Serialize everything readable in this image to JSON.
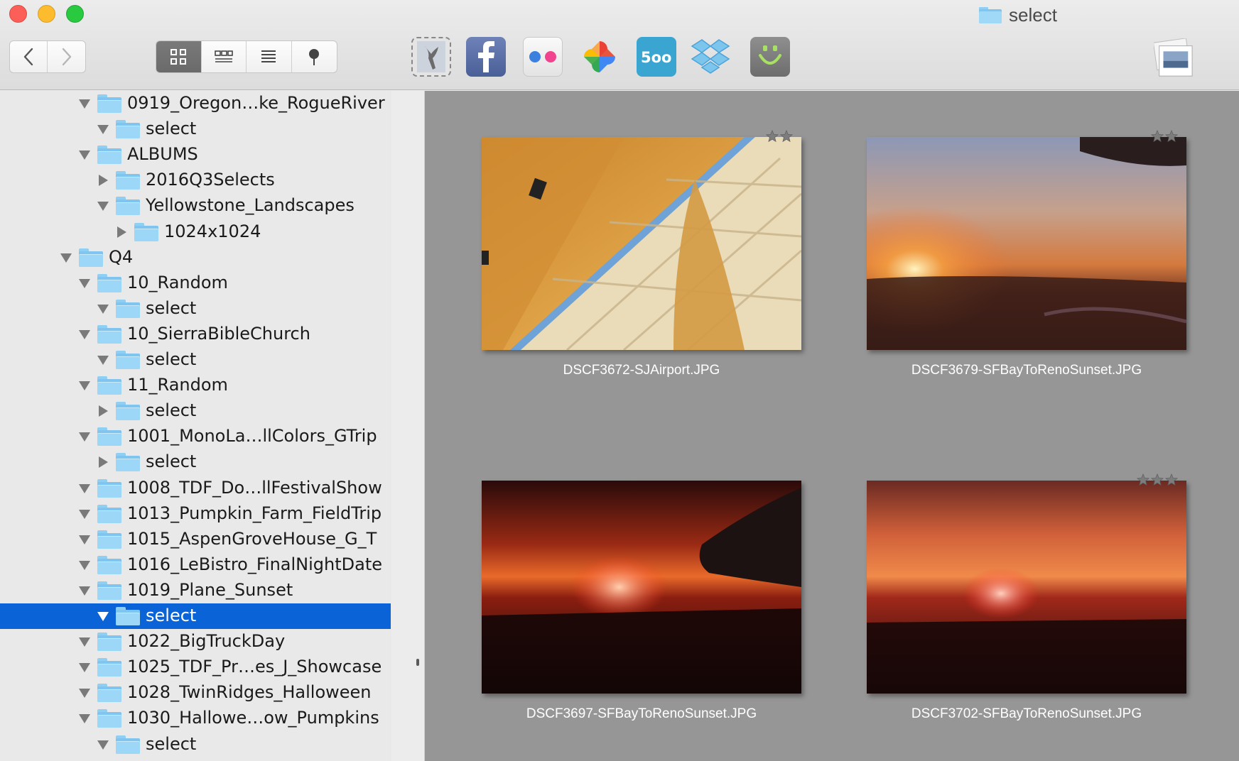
{
  "window": {
    "title": "select"
  },
  "toolbar": {
    "nav": [
      {
        "icon": "chevron-left-icon"
      },
      {
        "icon": "chevron-right-icon"
      }
    ],
    "view_modes": [
      {
        "icon": "grid-view-icon",
        "active": true
      },
      {
        "icon": "filmstrip-view-icon",
        "active": false
      },
      {
        "icon": "list-view-icon",
        "active": false
      },
      {
        "icon": "map-pin-icon",
        "active": false
      }
    ],
    "share_services": [
      "photos-hawk-icon",
      "facebook-icon",
      "flickr-icon",
      "google-photos-icon",
      "500px-icon",
      "dropbox-icon",
      "smugmug-icon"
    ],
    "slideshow_icon": "slideshow-icon"
  },
  "sidebar": {
    "items": [
      {
        "label": "0919_Oregon…ke_RogueRiver",
        "level": 2,
        "expanded": true,
        "selected": false
      },
      {
        "label": "select",
        "level": 3,
        "expanded": true,
        "selected": false
      },
      {
        "label": "ALBUMS",
        "level": 2,
        "expanded": true,
        "selected": false
      },
      {
        "label": "2016Q3Selects",
        "level": 3,
        "expanded": false,
        "selected": false
      },
      {
        "label": "Yellowstone_Landscapes",
        "level": 3,
        "expanded": true,
        "selected": false
      },
      {
        "label": "1024x1024",
        "level": 4,
        "expanded": false,
        "selected": false
      },
      {
        "label": "Q4",
        "level": 1,
        "expanded": true,
        "selected": false
      },
      {
        "label": "10_Random",
        "level": 2,
        "expanded": true,
        "selected": false
      },
      {
        "label": "select",
        "level": 3,
        "expanded": true,
        "selected": false
      },
      {
        "label": "10_SierraBibleChurch",
        "level": 2,
        "expanded": true,
        "selected": false
      },
      {
        "label": "select",
        "level": 3,
        "expanded": true,
        "selected": false
      },
      {
        "label": "11_Random",
        "level": 2,
        "expanded": true,
        "selected": false
      },
      {
        "label": "select",
        "level": 3,
        "expanded": false,
        "selected": false
      },
      {
        "label": "1001_MonoLa…llColors_GTrip",
        "level": 2,
        "expanded": true,
        "selected": false
      },
      {
        "label": "select",
        "level": 3,
        "expanded": false,
        "selected": false
      },
      {
        "label": "1008_TDF_Do…llFestivalShow",
        "level": 2,
        "expanded": true,
        "selected": false
      },
      {
        "label": "1013_Pumpkin_Farm_FieldTrip",
        "level": 2,
        "expanded": true,
        "selected": false
      },
      {
        "label": "1015_AspenGroveHouse_G_T",
        "level": 2,
        "expanded": true,
        "selected": false
      },
      {
        "label": "1016_LeBistro_FinalNightDate",
        "level": 2,
        "expanded": true,
        "selected": false
      },
      {
        "label": "1019_Plane_Sunset",
        "level": 2,
        "expanded": true,
        "selected": false
      },
      {
        "label": "select",
        "level": 3,
        "expanded": true,
        "selected": true
      },
      {
        "label": "1022_BigTruckDay",
        "level": 2,
        "expanded": true,
        "selected": false
      },
      {
        "label": "1025_TDF_Pr…es_J_Showcase",
        "level": 2,
        "expanded": true,
        "selected": false
      },
      {
        "label": "1028_TwinRidges_Halloween",
        "level": 2,
        "expanded": true,
        "selected": false
      },
      {
        "label": "1030_Hallowe…ow_Pumpkins",
        "level": 2,
        "expanded": true,
        "selected": false
      },
      {
        "label": "select",
        "level": 3,
        "expanded": true,
        "selected": false
      }
    ]
  },
  "photos": [
    {
      "filename": "DSCF3672-SJAirport.JPG",
      "scene": "airport",
      "stars": 2
    },
    {
      "filename": "DSCF3679-SFBayToRenoSunset.JPG",
      "scene": "sunset-wing-top",
      "stars": 2
    },
    {
      "filename": "DSCF3697-SFBayToRenoSunset.JPG",
      "scene": "sunset-wing-right",
      "stars": 0
    },
    {
      "filename": "DSCF3702-SFBayToRenoSunset.JPG",
      "scene": "sunset-clear",
      "stars": 3
    }
  ],
  "colors": {
    "selection": "#0b63d8",
    "content_bg": "#969696",
    "folder": "#7fc5ef"
  }
}
